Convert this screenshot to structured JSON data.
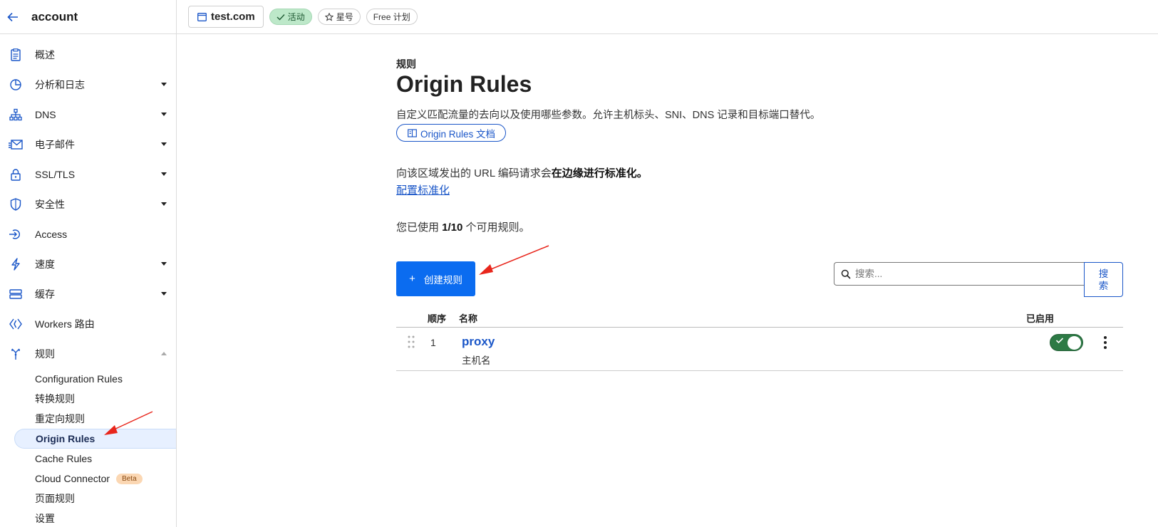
{
  "sidebar": {
    "account_title": "account",
    "items": [
      {
        "label": "概述",
        "icon": "document-icon"
      },
      {
        "label": "分析和日志",
        "icon": "pie-chart-icon"
      },
      {
        "label": "DNS",
        "icon": "network-icon"
      },
      {
        "label": "电子邮件",
        "icon": "mail-icon"
      },
      {
        "label": "SSL/TLS",
        "icon": "lock-icon"
      },
      {
        "label": "安全性",
        "icon": "shield-icon"
      },
      {
        "label": "Access",
        "icon": "access-icon"
      },
      {
        "label": "速度",
        "icon": "lightning-icon"
      },
      {
        "label": "缓存",
        "icon": "storage-icon"
      },
      {
        "label": "Workers 路由",
        "icon": "workers-icon"
      },
      {
        "label": "规则",
        "icon": "rules-icon"
      }
    ],
    "rules_sub": [
      {
        "label": "Configuration Rules"
      },
      {
        "label": "转换规则"
      },
      {
        "label": "重定向规则"
      },
      {
        "label": "Origin Rules"
      },
      {
        "label": "Cache Rules"
      },
      {
        "label": "Cloud Connector",
        "badge": "Beta"
      },
      {
        "label": "页面规则"
      },
      {
        "label": "设置"
      }
    ]
  },
  "topbar": {
    "zone": "test.com",
    "status": "活动",
    "star": "星号",
    "plan": "Free 计划"
  },
  "main": {
    "section_label": "规则",
    "title": "Origin Rules",
    "description": "自定义匹配流量的去向以及使用哪些参数。允许主机标头、SNI、DNS 记录和目标端口替代。",
    "doc_link": "Origin Rules 文档",
    "norm_prefix": "向该区域发出的 URL 编码请求会",
    "norm_bold": "在边缘进行标准化。",
    "config_link": "配置标准化",
    "usage_prefix": "您已使用 ",
    "usage_count": "1/10",
    "usage_suffix": " 个可用规则。",
    "create_button": "创建规则",
    "search_placeholder": "搜索...",
    "search_button": "搜索"
  },
  "table": {
    "columns": {
      "order": "顺序",
      "name": "名称",
      "enabled": "已启用"
    },
    "rows": [
      {
        "order": "1",
        "name": "proxy",
        "sub": "主机名",
        "enabled": true
      }
    ]
  },
  "colors": {
    "accent": "#1a56c8",
    "primary_button": "#0b6cf0",
    "toggle_on": "#2d7a45",
    "annotation_arrow": "#e8261c"
  }
}
